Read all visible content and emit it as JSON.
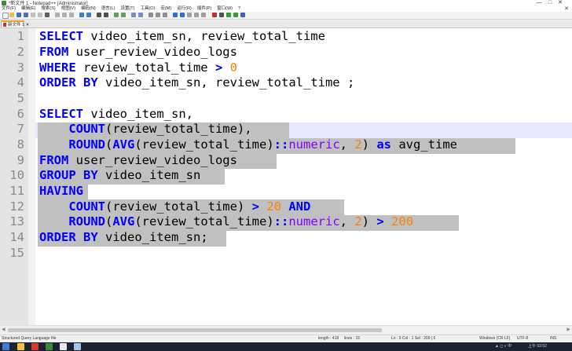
{
  "window": {
    "title": "*新文件 1 - Notepad++ [Administrator]",
    "controls": [
      "—",
      "□",
      "✕"
    ]
  },
  "menu": {
    "items": [
      "文件(F)",
      "编辑(E)",
      "搜索(S)",
      "视图(V)",
      "编码(N)",
      "语言(L)",
      "设置(T)",
      "工具(O)",
      "宏(M)",
      "运行(R)",
      "插件(P)",
      "窗口(W)",
      "?"
    ],
    "close_symbol": "✕"
  },
  "tab": {
    "label": "新文件 1 ✕"
  },
  "editor": {
    "line_numbers": [
      "1",
      "2",
      "3",
      "4",
      "5",
      "6",
      "7",
      "8",
      "9",
      "10",
      "11",
      "12",
      "13",
      "14",
      "15"
    ],
    "lines": [
      "SELECT video_item_sn, review_total_time",
      "FROM user_review_video_logs",
      "WHERE review_total_time > 0",
      "ORDER BY video_item_sn, review_total_time ;",
      "",
      "SELECT video_item_sn,",
      "    COUNT(review_total_time),",
      "    ROUND(AVG(review_total_time)::numeric, 2) as avg_time",
      "FROM user_review_video_logs",
      "GROUP BY video_item_sn",
      "HAVING",
      "    COUNT(review_total_time) > 20 AND",
      "    ROUND(AVG(review_total_time)::numeric, 2) > 200",
      "ORDER BY video_item_sn;",
      ""
    ]
  },
  "status": {
    "language": "Structured Query Language file",
    "length": "length : 418",
    "lines": "lines : 15",
    "position": "Ln : 9    Col : 1    Sel : 209 | 5",
    "eol": "Windows (CR LF)",
    "encoding": "UTF-8",
    "mode": "INS"
  },
  "taskbar": {
    "clock": "上午 03:52"
  },
  "colors": {
    "keyword": "#0000ff",
    "number": "#ff8000",
    "type": "#8000ff",
    "selection": "#c0c0c0",
    "caret_line": "#e8e8ff"
  }
}
